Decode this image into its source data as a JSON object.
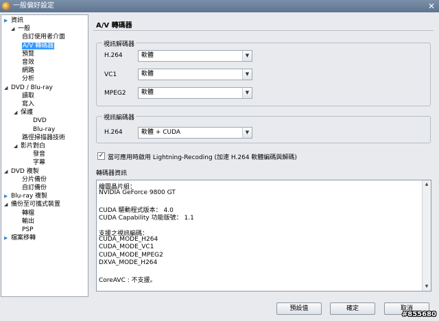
{
  "window": {
    "title": "一般偏好設定",
    "close_icon": "✕"
  },
  "tree": [
    {
      "label": "資訊",
      "arrow": "right"
    },
    {
      "label": "一般",
      "arrow": "down"
    },
    {
      "label": "自訂使用者介面",
      "arrow": ""
    },
    {
      "label": "A/V 轉碼器",
      "arrow": "",
      "selected": true
    },
    {
      "label": "預覽",
      "arrow": ""
    },
    {
      "label": "音效",
      "arrow": ""
    },
    {
      "label": "網路",
      "arrow": ""
    },
    {
      "label": "分析",
      "arrow": ""
    },
    {
      "label": "DVD / Blu-ray",
      "arrow": "down"
    },
    {
      "label": "讀取",
      "arrow": ""
    },
    {
      "label": "寫入",
      "arrow": ""
    },
    {
      "label": "保護",
      "arrow": "down"
    },
    {
      "label": "DVD",
      "arrow": ""
    },
    {
      "label": "Blu-ray",
      "arrow": ""
    },
    {
      "label": "路徑掃描器技術",
      "arrow": ""
    },
    {
      "label": "影片對白",
      "arrow": "down"
    },
    {
      "label": "發音",
      "arrow": ""
    },
    {
      "label": "字幕",
      "arrow": ""
    },
    {
      "label": "DVD 複製",
      "arrow": "down"
    },
    {
      "label": "分片備份",
      "arrow": ""
    },
    {
      "label": "自訂備份",
      "arrow": ""
    },
    {
      "label": "Blu-ray 複製",
      "arrow": "right"
    },
    {
      "label": "備份至可攜式裝置",
      "arrow": "down"
    },
    {
      "label": "轉檔",
      "arrow": ""
    },
    {
      "label": "輸出",
      "arrow": ""
    },
    {
      "label": "PSP",
      "arrow": ""
    },
    {
      "label": "檔案移轉",
      "arrow": "right"
    }
  ],
  "panel": {
    "title": "A/V 轉碼器",
    "decoder_group": {
      "label": "視訊解碼器",
      "rows": [
        {
          "label": "H.264",
          "value": "軟體"
        },
        {
          "label": "VC1",
          "value": "軟體"
        },
        {
          "label": "MPEG2",
          "value": "軟體"
        }
      ]
    },
    "encoder_group": {
      "label": "視訊編碼器",
      "rows": [
        {
          "label": "H.264",
          "value": "軟體 + CUDA"
        }
      ]
    },
    "lightning": {
      "checked": true,
      "check_mark": "✓",
      "label": "當可應用時啟用 Lightning-Recoding (加速 H.264 軟體編碼與解碼)"
    },
    "info": {
      "title": "轉碼器資訊",
      "lines": [
        "繪圖晶片組：",
        "NVIDIA GeForce 9800 GT",
        "",
        "CUDA 驅動程式版本： 4.0",
        "CUDA Capability 功能版號： 1.1",
        "",
        "支援之視訊編碼：",
        "CUDA_MODE_H264",
        "CUDA_MODE_VC1",
        "CUDA_MODE_MPEG2",
        "DXVA_MODE_H264",
        "",
        "CoreAVC : 不支援。"
      ]
    }
  },
  "buttons": {
    "default_label": "預設值",
    "ok_label": "確定",
    "cancel_label": "取消"
  },
  "watermark": "#855680",
  "icons": {
    "dropdown": "▼",
    "scroll_up": "▲",
    "scroll_down": "▼",
    "tree_right": "▶",
    "tree_down": "◢"
  }
}
